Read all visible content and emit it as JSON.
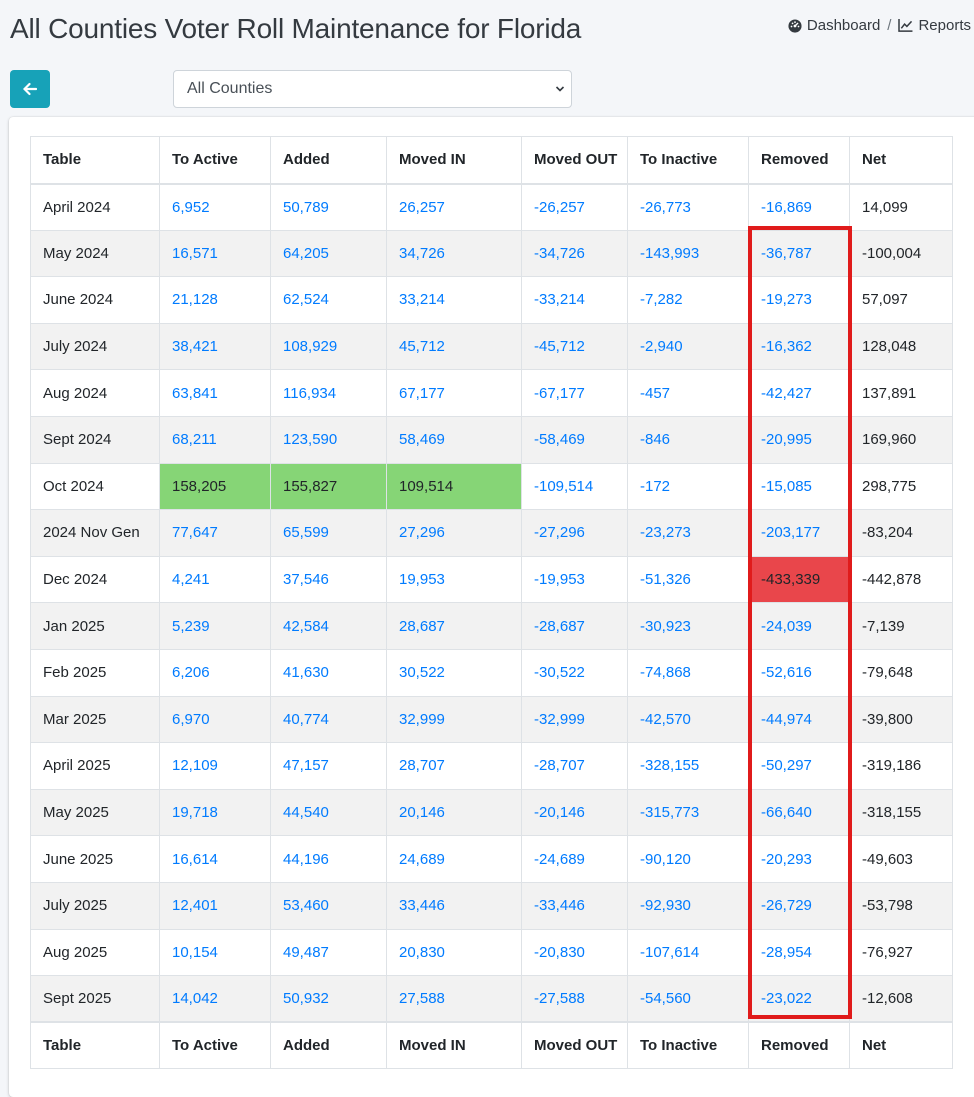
{
  "header": {
    "title": "All Counties Voter Roll Maintenance for Florida",
    "breadcrumb": [
      {
        "label": "Dashboard",
        "icon": "dashboard-icon"
      },
      {
        "label": "Reports",
        "icon": "chart-line-icon"
      }
    ],
    "separator": "/"
  },
  "controls": {
    "back_icon": "arrow-left-icon",
    "county_select": {
      "selected": "All Counties"
    }
  },
  "table": {
    "columns": [
      "Table",
      "To Active",
      "Added",
      "Moved IN",
      "Moved OUT",
      "To Inactive",
      "Removed",
      "Net"
    ],
    "rows": [
      [
        "April 2024",
        "6,952",
        "50,789",
        "26,257",
        "-26,257",
        "-26,773",
        "-16,869",
        "14,099"
      ],
      [
        "May 2024",
        "16,571",
        "64,205",
        "34,726",
        "-34,726",
        "-143,993",
        "-36,787",
        "-100,004"
      ],
      [
        "June 2024",
        "21,128",
        "62,524",
        "33,214",
        "-33,214",
        "-7,282",
        "-19,273",
        "57,097"
      ],
      [
        "July 2024",
        "38,421",
        "108,929",
        "45,712",
        "-45,712",
        "-2,940",
        "-16,362",
        "128,048"
      ],
      [
        "Aug 2024",
        "63,841",
        "116,934",
        "67,177",
        "-67,177",
        "-457",
        "-42,427",
        "137,891"
      ],
      [
        "Sept 2024",
        "68,211",
        "123,590",
        "58,469",
        "-58,469",
        "-846",
        "-20,995",
        "169,960"
      ],
      [
        "Oct 2024",
        "158,205",
        "155,827",
        "109,514",
        "-109,514",
        "-172",
        "-15,085",
        "298,775"
      ],
      [
        "2024 Nov Gen",
        "77,647",
        "65,599",
        "27,296",
        "-27,296",
        "-23,273",
        "-203,177",
        "-83,204"
      ],
      [
        "Dec 2024",
        "4,241",
        "37,546",
        "19,953",
        "-19,953",
        "-51,326",
        "-433,339",
        "-442,878"
      ],
      [
        "Jan 2025",
        "5,239",
        "42,584",
        "28,687",
        "-28,687",
        "-30,923",
        "-24,039",
        "-7,139"
      ],
      [
        "Feb 2025",
        "6,206",
        "41,630",
        "30,522",
        "-30,522",
        "-74,868",
        "-52,616",
        "-79,648"
      ],
      [
        "Mar 2025",
        "6,970",
        "40,774",
        "32,999",
        "-32,999",
        "-42,570",
        "-44,974",
        "-39,800"
      ],
      [
        "April 2025",
        "12,109",
        "47,157",
        "28,707",
        "-28,707",
        "-328,155",
        "-50,297",
        "-319,186"
      ],
      [
        "May 2025",
        "19,718",
        "44,540",
        "20,146",
        "-20,146",
        "-315,773",
        "-66,640",
        "-318,155"
      ],
      [
        "June 2025",
        "16,614",
        "44,196",
        "24,689",
        "-24,689",
        "-90,120",
        "-20,293",
        "-49,603"
      ],
      [
        "July 2025",
        "12,401",
        "53,460",
        "33,446",
        "-33,446",
        "-92,930",
        "-26,729",
        "-53,798"
      ],
      [
        "Aug 2025",
        "10,154",
        "49,487",
        "20,830",
        "-20,830",
        "-107,614",
        "-28,954",
        "-76,927"
      ],
      [
        "Sept 2025",
        "14,042",
        "50,932",
        "27,588",
        "-27,588",
        "-54,560",
        "-23,022",
        "-12,608"
      ]
    ],
    "highlights": [
      {
        "row": 6,
        "col": 1,
        "color": "#86d576"
      },
      {
        "row": 6,
        "col": 2,
        "color": "#86d576"
      },
      {
        "row": 6,
        "col": 3,
        "color": "#86d576"
      },
      {
        "row": 8,
        "col": 6,
        "color": "#e9464b"
      }
    ],
    "annotation_box": {
      "column": 6,
      "from_row": 1,
      "to_row": 17,
      "color": "#e01b1b"
    }
  },
  "colors": {
    "accent": "#17a2b8",
    "link": "#007bff"
  }
}
